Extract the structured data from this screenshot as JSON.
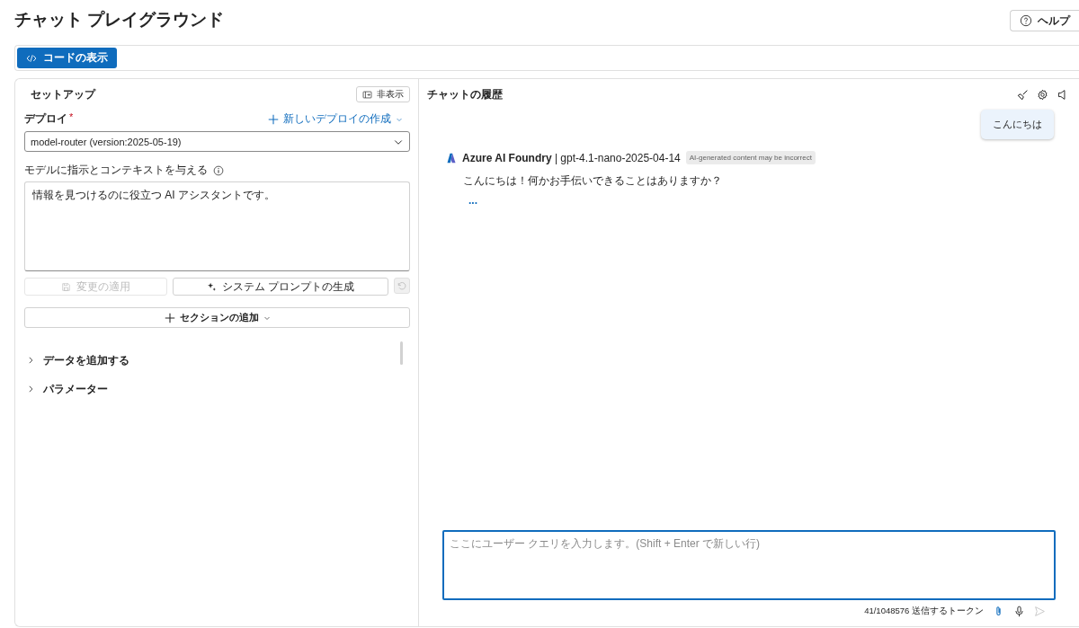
{
  "page": {
    "title": "チャット プレイグラウンド",
    "help_button": "ヘルプ"
  },
  "toolbar": {
    "view_code_button": "コードの表示"
  },
  "setup": {
    "title": "セットアップ",
    "hide_button": "非表示",
    "deploy_label": "デプロイ",
    "required_mark": "*",
    "new_deploy_link": "新しいデプロイの作成",
    "deployment": "model-router (version:2025-05-19)",
    "instructions_label": "モデルに指示とコンテキストを与える",
    "instructions": "情報を見つけるのに役立つ AI アシスタントです。",
    "apply_button": {
      "label": "変更の適用",
      "disabled": true
    },
    "generate_button": {
      "label": "システム プロンプトの生成",
      "disabled": false
    },
    "reset_button": {
      "disabled": true
    },
    "add_section_button": "セクションの追加",
    "sections": [
      {
        "label": "データを追加する",
        "expanded": false
      },
      {
        "label": "パラメーター",
        "expanded": false
      }
    ]
  },
  "chat": {
    "title": "チャットの履歴",
    "messages": [
      {
        "kind": "user",
        "text": "こんにちは"
      },
      {
        "kind": "assistant",
        "header": "**Azure AI Foundry** | gpt-4.1-nano-2025-04-14",
        "badge": "AI-generated content may be incorrect",
        "text": "こんにちは！何かお手伝いできることはありますか？",
        "more": "..."
      }
    ],
    "input_placeholder": "ここにユーザー クエリを入力します。(Shift + Enter で新しい行)",
    "token_count": "41/1048576 送信するトークン"
  }
}
